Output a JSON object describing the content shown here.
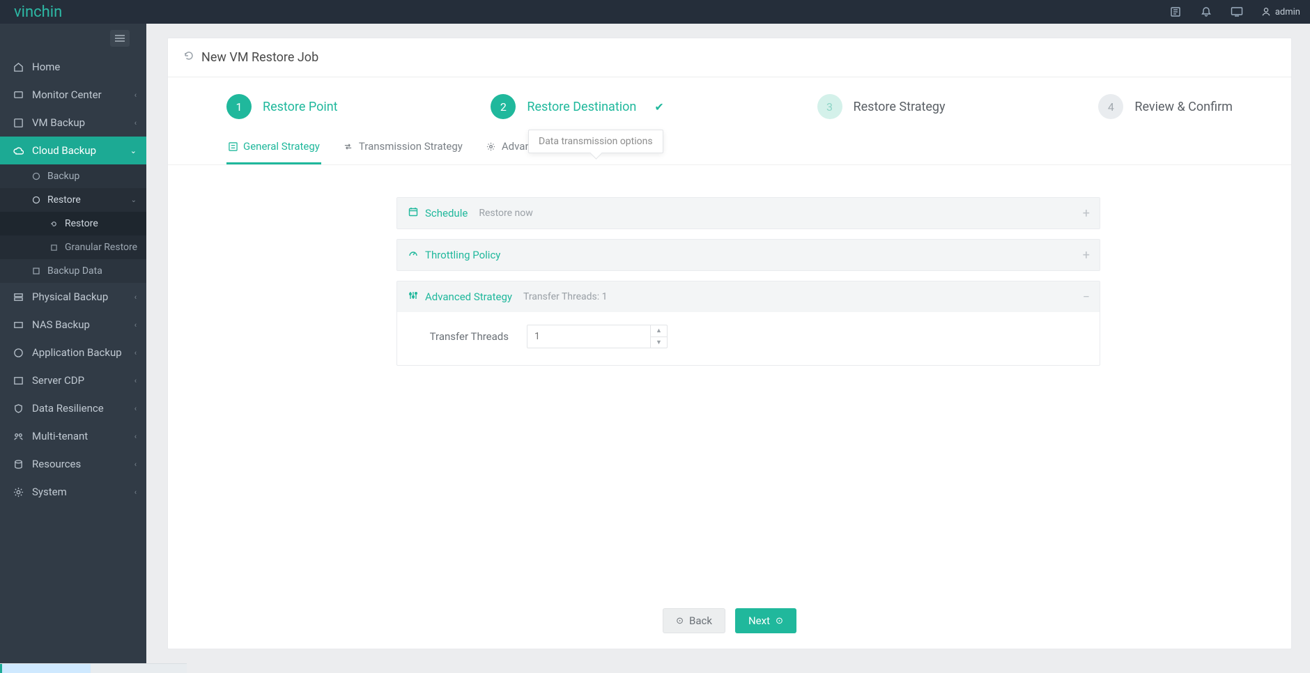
{
  "brand": "vinchin",
  "topbar": {
    "user_label": "admin"
  },
  "sidebar": {
    "items": [
      {
        "label": "Home"
      },
      {
        "label": "Monitor Center"
      },
      {
        "label": "VM Backup"
      },
      {
        "label": "Cloud Backup"
      },
      {
        "label": "Physical Backup"
      },
      {
        "label": "NAS Backup"
      },
      {
        "label": "Application Backup"
      },
      {
        "label": "Server CDP"
      },
      {
        "label": "Data Resilience"
      },
      {
        "label": "Multi-tenant"
      },
      {
        "label": "Resources"
      },
      {
        "label": "System"
      }
    ],
    "cloud_sub": {
      "backup": "Backup",
      "restore": "Restore",
      "restore_sub": {
        "restore": "Restore",
        "granular": "Granular Restore"
      },
      "backup_data": "Backup Data"
    }
  },
  "page": {
    "title": "New VM Restore Job"
  },
  "stepper": {
    "s1": {
      "num": "1",
      "label": "Restore Point"
    },
    "s2": {
      "num": "2",
      "label": "Restore Destination"
    },
    "s3": {
      "num": "3",
      "label": "Restore Strategy"
    },
    "s4": {
      "num": "4",
      "label": "Review & Confirm"
    }
  },
  "tabs": {
    "general": "General Strategy",
    "transmission": "Transmission Strategy",
    "advanced": "Advanced Strategy"
  },
  "tooltip": "Data transmission options",
  "cards": {
    "schedule": {
      "title": "Schedule",
      "extra": "Restore now"
    },
    "throttling": {
      "title": "Throttling Policy"
    },
    "advanced": {
      "title": "Advanced Strategy",
      "extra": "Transfer Threads: 1"
    }
  },
  "form": {
    "transfer_threads_label": "Transfer Threads",
    "transfer_threads_value": "1"
  },
  "footer": {
    "back": "Back",
    "next": "Next"
  }
}
